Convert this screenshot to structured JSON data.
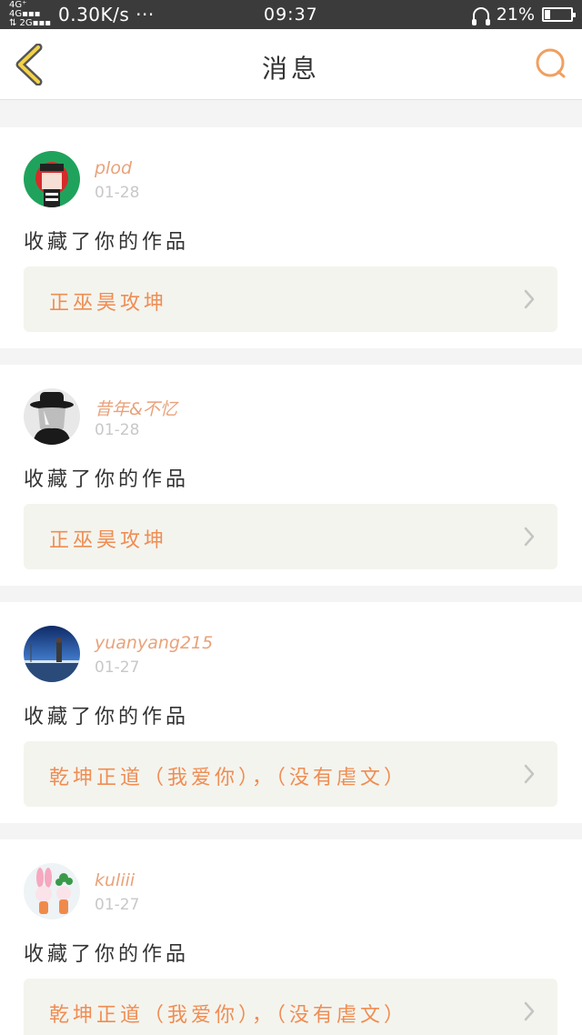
{
  "status_bar": {
    "network": "4G⁺ 4G\n2G",
    "speed": "0.30K/s ···",
    "time": "09:37",
    "battery": "21%",
    "battery_level": 0.21
  },
  "nav": {
    "title": "消息",
    "back_icon": "chevron-left-icon",
    "search_icon": "search-icon",
    "accent_color": "#f0a060"
  },
  "messages": [
    {
      "username": "plod",
      "date": "01-28",
      "action": "收藏了你的作品",
      "work_title": "正巫昊攻坤"
    },
    {
      "username": "昔年&不忆",
      "date": "01-28",
      "action": "收藏了你的作品",
      "work_title": "正巫昊攻坤"
    },
    {
      "username": "yuanyang215",
      "date": "01-27",
      "action": "收藏了你的作品",
      "work_title": "乾坤正道（我爱你），（没有虐文）"
    },
    {
      "username": "kuliii",
      "date": "01-27",
      "action": "收藏了你的作品",
      "work_title": "乾坤正道（我爱你），（没有虐文）"
    }
  ],
  "colors": {
    "username": "#e9a27a",
    "work_title": "#ef8d53",
    "work_card_bg": "#f4f4ee"
  }
}
